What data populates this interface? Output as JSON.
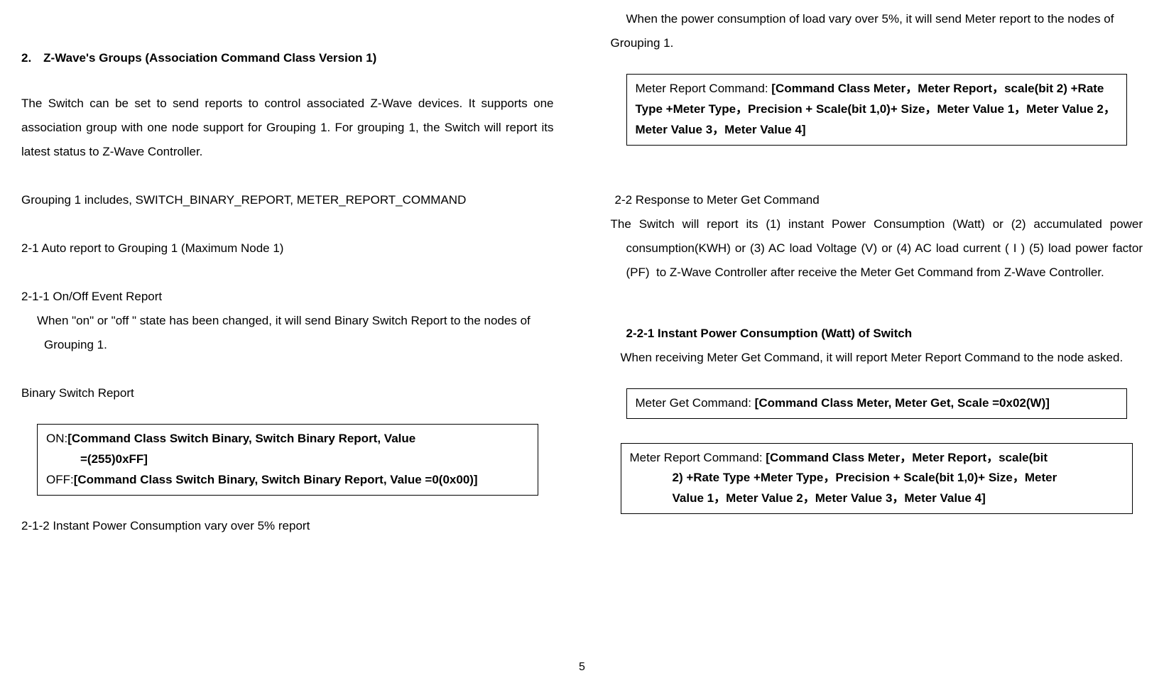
{
  "page_number": "5",
  "left": {
    "section_title": "2. Z-Wave's Groups (Association Command Class Version 1)",
    "para1": "The Switch can be set to send reports to control associated Z-Wave devices.  It supports one association group with one node support for Grouping 1. For grouping 1, the Switch will report its latest status to Z-Wave Controller.",
    "para2": "Grouping 1 includes, SWITCH_BINARY_REPORT, METER_REPORT_COMMAND",
    "sub21": " 2-1 Auto report to Grouping 1 (Maximum Node 1)",
    "sub211": "  2-1-1 On/Off Event Report",
    "sub211_text": "When \"on\" or \"off \" state has been changed, it will send Binary Switch Report to the nodes of Grouping 1.",
    "bsr_label": "Binary Switch Report",
    "box1": {
      "on_label": "ON:",
      "on_value_line1": "[Command Class Switch Binary, Switch Binary Report, Value",
      "on_value_line2": "=(255)0xFF]",
      "off_label": "OFF:",
      "off_value": "[Command Class Switch Binary, Switch Binary Report, Value =0(0x00)]"
    },
    "sub212": "  2-1-2 Instant Power Consumption vary over 5% report"
  },
  "right": {
    "top_para": "When the power consumption of load vary over 5%, it will send Meter report to the nodes of Grouping 1.",
    "box2": {
      "prefix": "Meter Report Command: ",
      "content": "[Command Class Meter，Meter Report，scale(bit 2) +Rate Type +Meter Type，Precision + Scale(bit 1,0)+ Size，Meter Value 1，Meter Value 2，Meter Value 3，Meter Value 4]"
    },
    "sub22": "2-2 Response to Meter Get Command",
    "sub22_text": "The Switch will report its (1) instant Power Consumption (Watt)  or (2) accumulated power consumption(KWH) or (3) AC load Voltage (V) or (4) AC load current ( I ) (5) load power factor (PF)  to Z-Wave Controller after receive the Meter Get Command from Z-Wave Controller.",
    "sub221_title": "2-2-1 Instant Power Consumption (Watt) of Switch",
    "sub221_text": "When receiving Meter Get Command, it will report Meter Report Command to the node asked.",
    "box3": {
      "prefix": "Meter Get Command: ",
      "content": "[Command Class Meter, Meter Get, Scale =0x02(W)]"
    },
    "box4": {
      "prefix": "Meter Report Command: ",
      "line1": "[Command Class Meter，Meter Report，scale(bit",
      "line2": "2) +Rate Type +Meter Type，Precision + Scale(bit 1,0)+ Size，Meter",
      "line3": "Value 1，Meter Value 2，Meter Value 3，Meter Value 4]"
    }
  }
}
